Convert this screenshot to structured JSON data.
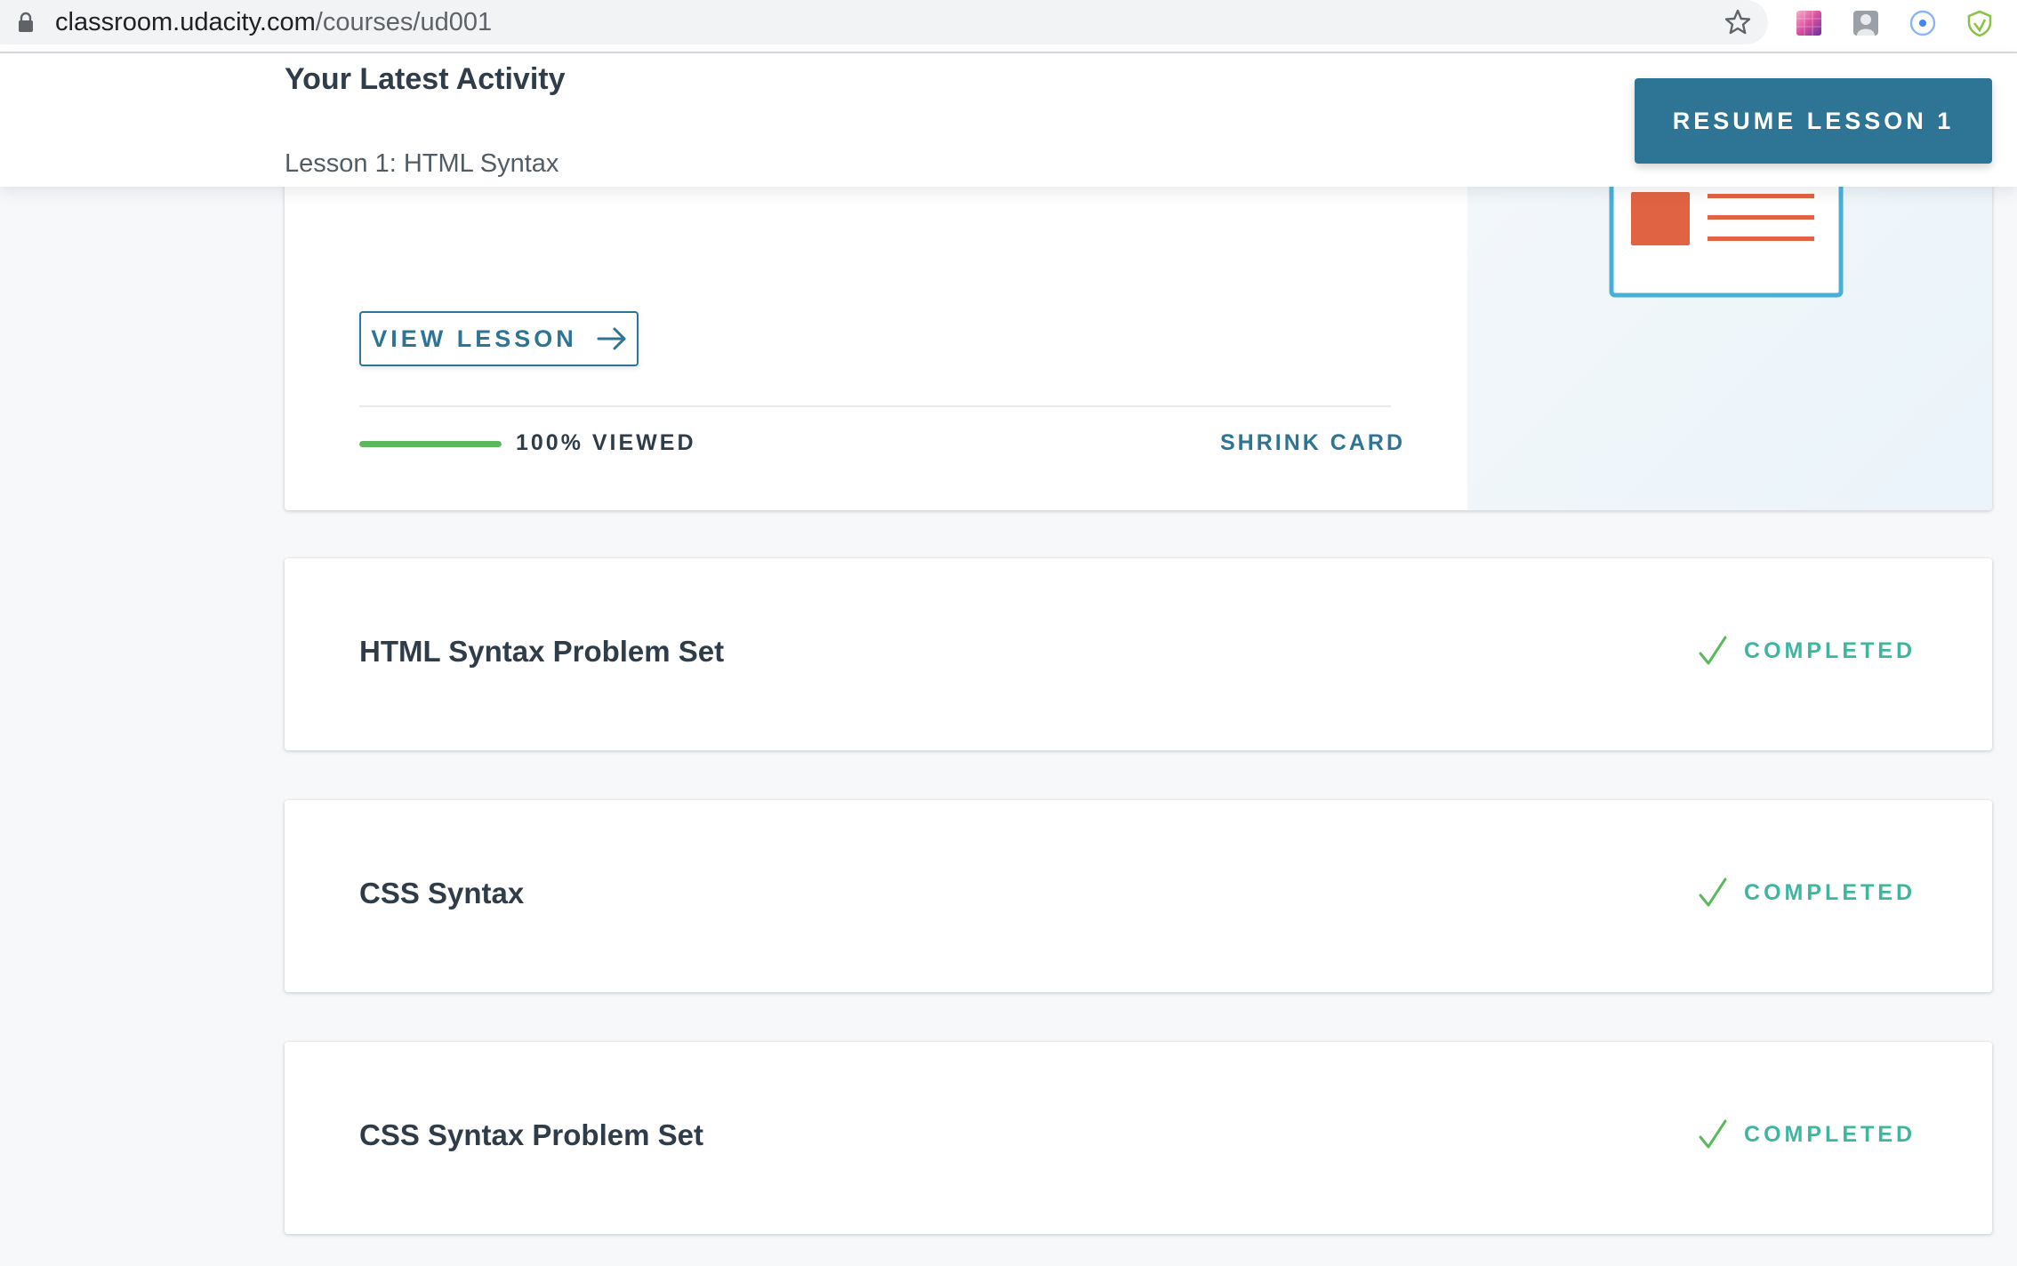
{
  "browser": {
    "url_domain": "classroom.udacity.com",
    "url_path": "/courses/ud001"
  },
  "activity": {
    "title": "Your Latest Activity",
    "subtitle": "Lesson 1: HTML Syntax",
    "resume_label": "RESUME LESSON 1"
  },
  "lesson_card": {
    "view_label": "VIEW LESSON",
    "progress_percent": 100,
    "progress_label": "100% VIEWED",
    "shrink_label": "SHRINK CARD"
  },
  "items": [
    {
      "title": "HTML Syntax Problem Set",
      "status": "COMPLETED"
    },
    {
      "title": "CSS Syntax",
      "status": "COMPLETED"
    },
    {
      "title": "CSS Syntax Problem Set",
      "status": "COMPLETED"
    }
  ],
  "colors": {
    "accent": "#2e7495",
    "progress": "#5cb85c",
    "completed": "#3fb5a0",
    "illustration_orange": "#e06343",
    "illustration_blue": "#4aafd7"
  },
  "icons": {
    "lock": "lock-icon",
    "star": "star-icon",
    "arrow": "arrow-right-icon",
    "check": "check-icon"
  }
}
